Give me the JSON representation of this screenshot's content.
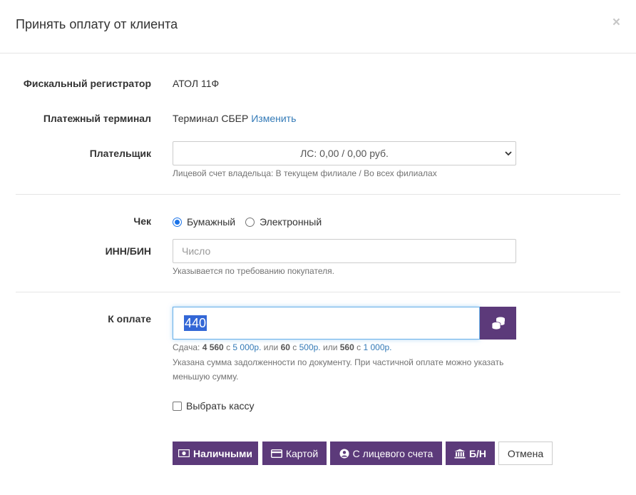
{
  "modal": {
    "title": "Принять оплату от клиента",
    "close": "×"
  },
  "fiscal": {
    "label": "Фискальный регистратор",
    "value": "АТОЛ 11Ф"
  },
  "terminal": {
    "label": "Платежный терминал",
    "value": "Терминал СБЕР",
    "change_link": "Изменить"
  },
  "payer": {
    "label": "Плательщик",
    "selected": "ЛС: 0,00 / 0,00 руб.",
    "help": "Лицевой счет владельца: В текущем филиале / Во всех филиалах"
  },
  "receipt": {
    "label": "Чек",
    "options": [
      "Бумажный",
      "Электронный"
    ],
    "selected": "Бумажный"
  },
  "inn": {
    "label": "ИНН/БИН",
    "placeholder": "Число",
    "help": "Указывается по требованию покупателя."
  },
  "amount": {
    "label": "К оплате",
    "value": "440",
    "change": {
      "prefix": "Сдача:",
      "items": [
        {
          "change": "4 560",
          "with": "с",
          "bill": "5 000р.",
          "sep": "или"
        },
        {
          "change": "60",
          "with": "с",
          "bill": "500р.",
          "sep": "или"
        },
        {
          "change": "560",
          "with": "с",
          "bill": "1 000р.",
          "sep": ""
        }
      ]
    },
    "note": "Указана сумма задолженности по документу. При частичной оплате можно указать меньшую сумму."
  },
  "choose_cashbox": {
    "label": "Выбрать кассу",
    "checked": false
  },
  "buttons": {
    "cash": "Наличными",
    "card": "Картой",
    "account": "С лицевого счета",
    "cashless": "Б/Н",
    "cancel": "Отмена"
  },
  "colors": {
    "accent": "#5c3a7a",
    "link": "#337ab7",
    "focus": "#66afe9",
    "selection": "#3367d6"
  },
  "icons": {
    "close": "close-icon",
    "chevron": "chevron-down-icon",
    "coins": "coins-icon",
    "cash": "money-bill-icon",
    "card": "credit-card-icon",
    "account": "user-circle-icon",
    "bank": "bank-icon"
  }
}
